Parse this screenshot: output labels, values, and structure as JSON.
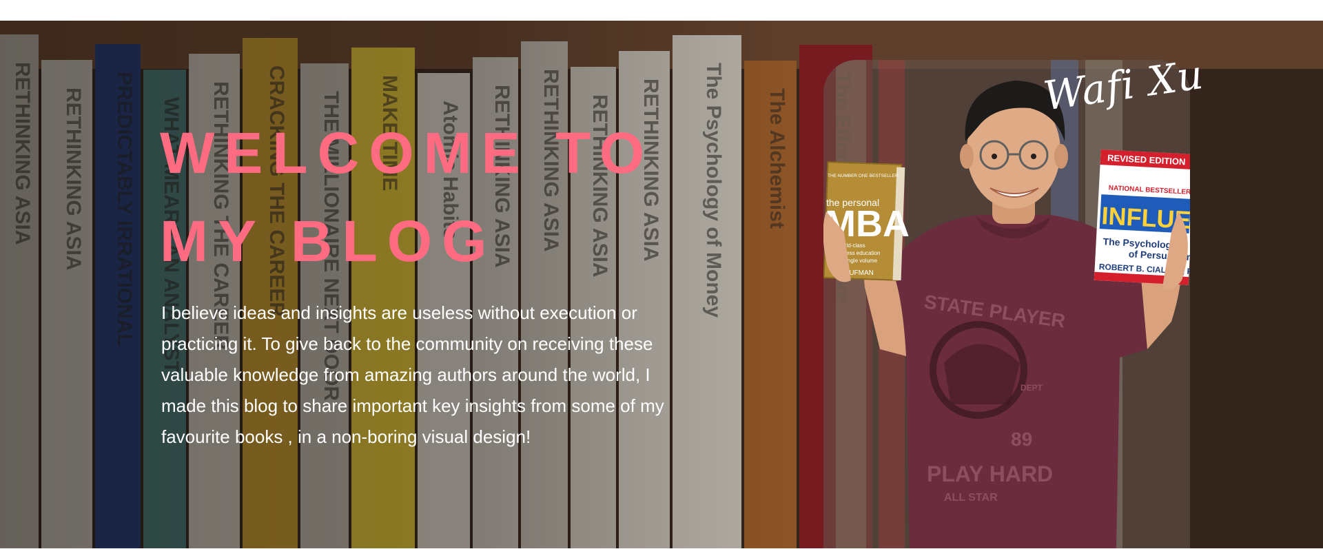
{
  "hero": {
    "headline_line1": "WELCOME TO",
    "headline_line2": "MY BLOG",
    "intro": "I believe ideas and insights are useless without execution or practicing it. To give back to the community on receiving these valuable knowledge from amazing authors around the world, I made this blog to share important key insights from some of my favourite books , in a non-boring visual design!",
    "signature": "Wafi Xu",
    "colors": {
      "headline": "#ff6b81",
      "body_text": "#ffffff",
      "shirt": "#6b2c3d",
      "influence_red": "#d4202c",
      "influence_blue": "#1f5bb8"
    }
  },
  "books_left_hand": {
    "badge": "THE NUMBER ONE BESTSELLER",
    "title_small": "the personal",
    "title_big": "MBA",
    "subtitle": "a world-class business education in a single volume",
    "author": "KAUFMAN"
  },
  "books_right_hand": {
    "edition": "REVISED EDITION",
    "badge": "NATIONAL BESTSELLER",
    "title": "INFLUENCE",
    "subtitle": "The Psychology of Persuasion",
    "author": "ROBERT B. CIALDINI, Ph.D."
  },
  "shirt_print": {
    "line1": "STATE PLAYER",
    "line2": "PLAY HARD",
    "line3": "ALL STAR",
    "number": "89",
    "tag": "DEPT"
  },
  "shelf_spines": [
    {
      "title": "RETHINKING ASIA",
      "color": "#b9b2a6"
    },
    {
      "title": "RETHINKING ASIA",
      "color": "#c7c1b6"
    },
    {
      "title": "PREDICTABLY IRRATIONAL",
      "color": "#2b3f7a"
    },
    {
      "title": "WHAT MEARS AN ANALYST",
      "color": "#4f7d78"
    },
    {
      "title": "RETHINKING THE CAREER",
      "color": "#cbc5b9"
    },
    {
      "title": "CRACKING THE CAREER",
      "color": "#c99a34"
    },
    {
      "title": "THE MILLIONAIRE NEXT DOOR",
      "color": "#bdb6aa"
    },
    {
      "title": "MAKE TIME",
      "color": "#e2c43a"
    },
    {
      "title": "Atomic Habits",
      "color": "#d9d3c8"
    },
    {
      "title": "RETHINKING ASIA",
      "color": "#ccc6bb"
    },
    {
      "title": "RETHINKING ASIA",
      "color": "#c4beb3"
    },
    {
      "title": "RETHINKING ASIA",
      "color": "#cfc9be"
    },
    {
      "title": "RETHINKING ASIA",
      "color": "#d6d0c6"
    },
    {
      "title": "The Psychology of Money",
      "color": "#d8d3c9"
    },
    {
      "title": "The Alchemist",
      "color": "#a8642e"
    },
    {
      "title": "The Effective Executive",
      "color": "#8b1e25"
    }
  ]
}
